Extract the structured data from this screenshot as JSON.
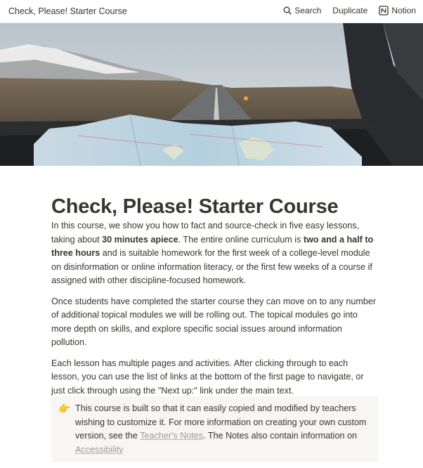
{
  "topbar": {
    "site_title": "Check, Please! Starter Course",
    "search_label": "Search",
    "duplicate_label": "Duplicate",
    "notion_label": "Notion"
  },
  "page": {
    "title": "Check, Please! Starter Course",
    "p1": {
      "a": "In this course, we show you how to fact and source-check in five easy lessons, taking about ",
      "b": "30 minutes apiece",
      "c": ". The entire online curriculum is ",
      "d": "two and a half to three hours",
      "e": " and is suitable homework for the first week of a college-level module on disinformation or online information literacy, or the first few weeks of a course if assigned with other discipline-focused homework."
    },
    "p2": "Once students have completed the starter course they can move on to any number of additional topical modules we will be rolling out. The topical modules go into more depth on skills, and explore specific social issues around information pollution.",
    "p3": "Each lesson has multiple pages and activities. After clicking through to each lesson, you can use the list of links at the bottom of the first page to navigate, or just click through using the \"Next up:\" link under the main text."
  },
  "callout": {
    "emoji": "👉",
    "text_a": "This course is built so that it can easily copied and modified by teachers wishing to customize it. For more information on creating your own custom version, see the ",
    "link_teachers": "Teacher's Notes",
    "text_b": ". The Notes also contain information on ",
    "link_accessibility": "Accessibility"
  }
}
